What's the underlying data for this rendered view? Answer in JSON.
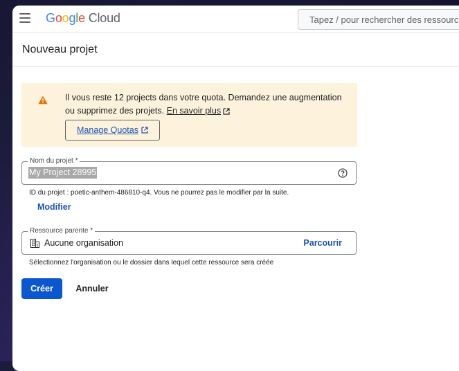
{
  "header": {
    "logo_word": "Google",
    "logo_product": "Cloud",
    "search_placeholder": "Tapez / pour rechercher des ressourc"
  },
  "page": {
    "title": "Nouveau projet"
  },
  "quota_banner": {
    "message": "Il vous reste 12 projects dans votre quota. Demandez une augmentation ou supprimez des projets.",
    "learn_more_label": "En savoir plus",
    "manage_button_label": "Manage Quotas"
  },
  "project_name": {
    "label": "Nom du projet *",
    "value": "My Project 28995",
    "id_hint": "ID du projet : poetic-anthem-486810-q4. Vous ne pourrez pas le modifier par la suite.",
    "edit_label": "Modifier"
  },
  "parent_resource": {
    "label": "Ressource parente *",
    "value": "Aucune organisation",
    "browse_label": "Parcourir",
    "hint": "Sélectionnez l'organisation ou le dossier dans lequel cette ressource sera créée"
  },
  "actions": {
    "create_label": "Créer",
    "cancel_label": "Annuler"
  },
  "colors": {
    "accent": "#0b57d0",
    "link": "#1a53b5",
    "banner_bg": "#fdf3dd",
    "warning": "#e37400"
  },
  "icons": [
    "menu-icon",
    "warning-icon",
    "external-link-icon",
    "help-icon",
    "organization-icon"
  ]
}
